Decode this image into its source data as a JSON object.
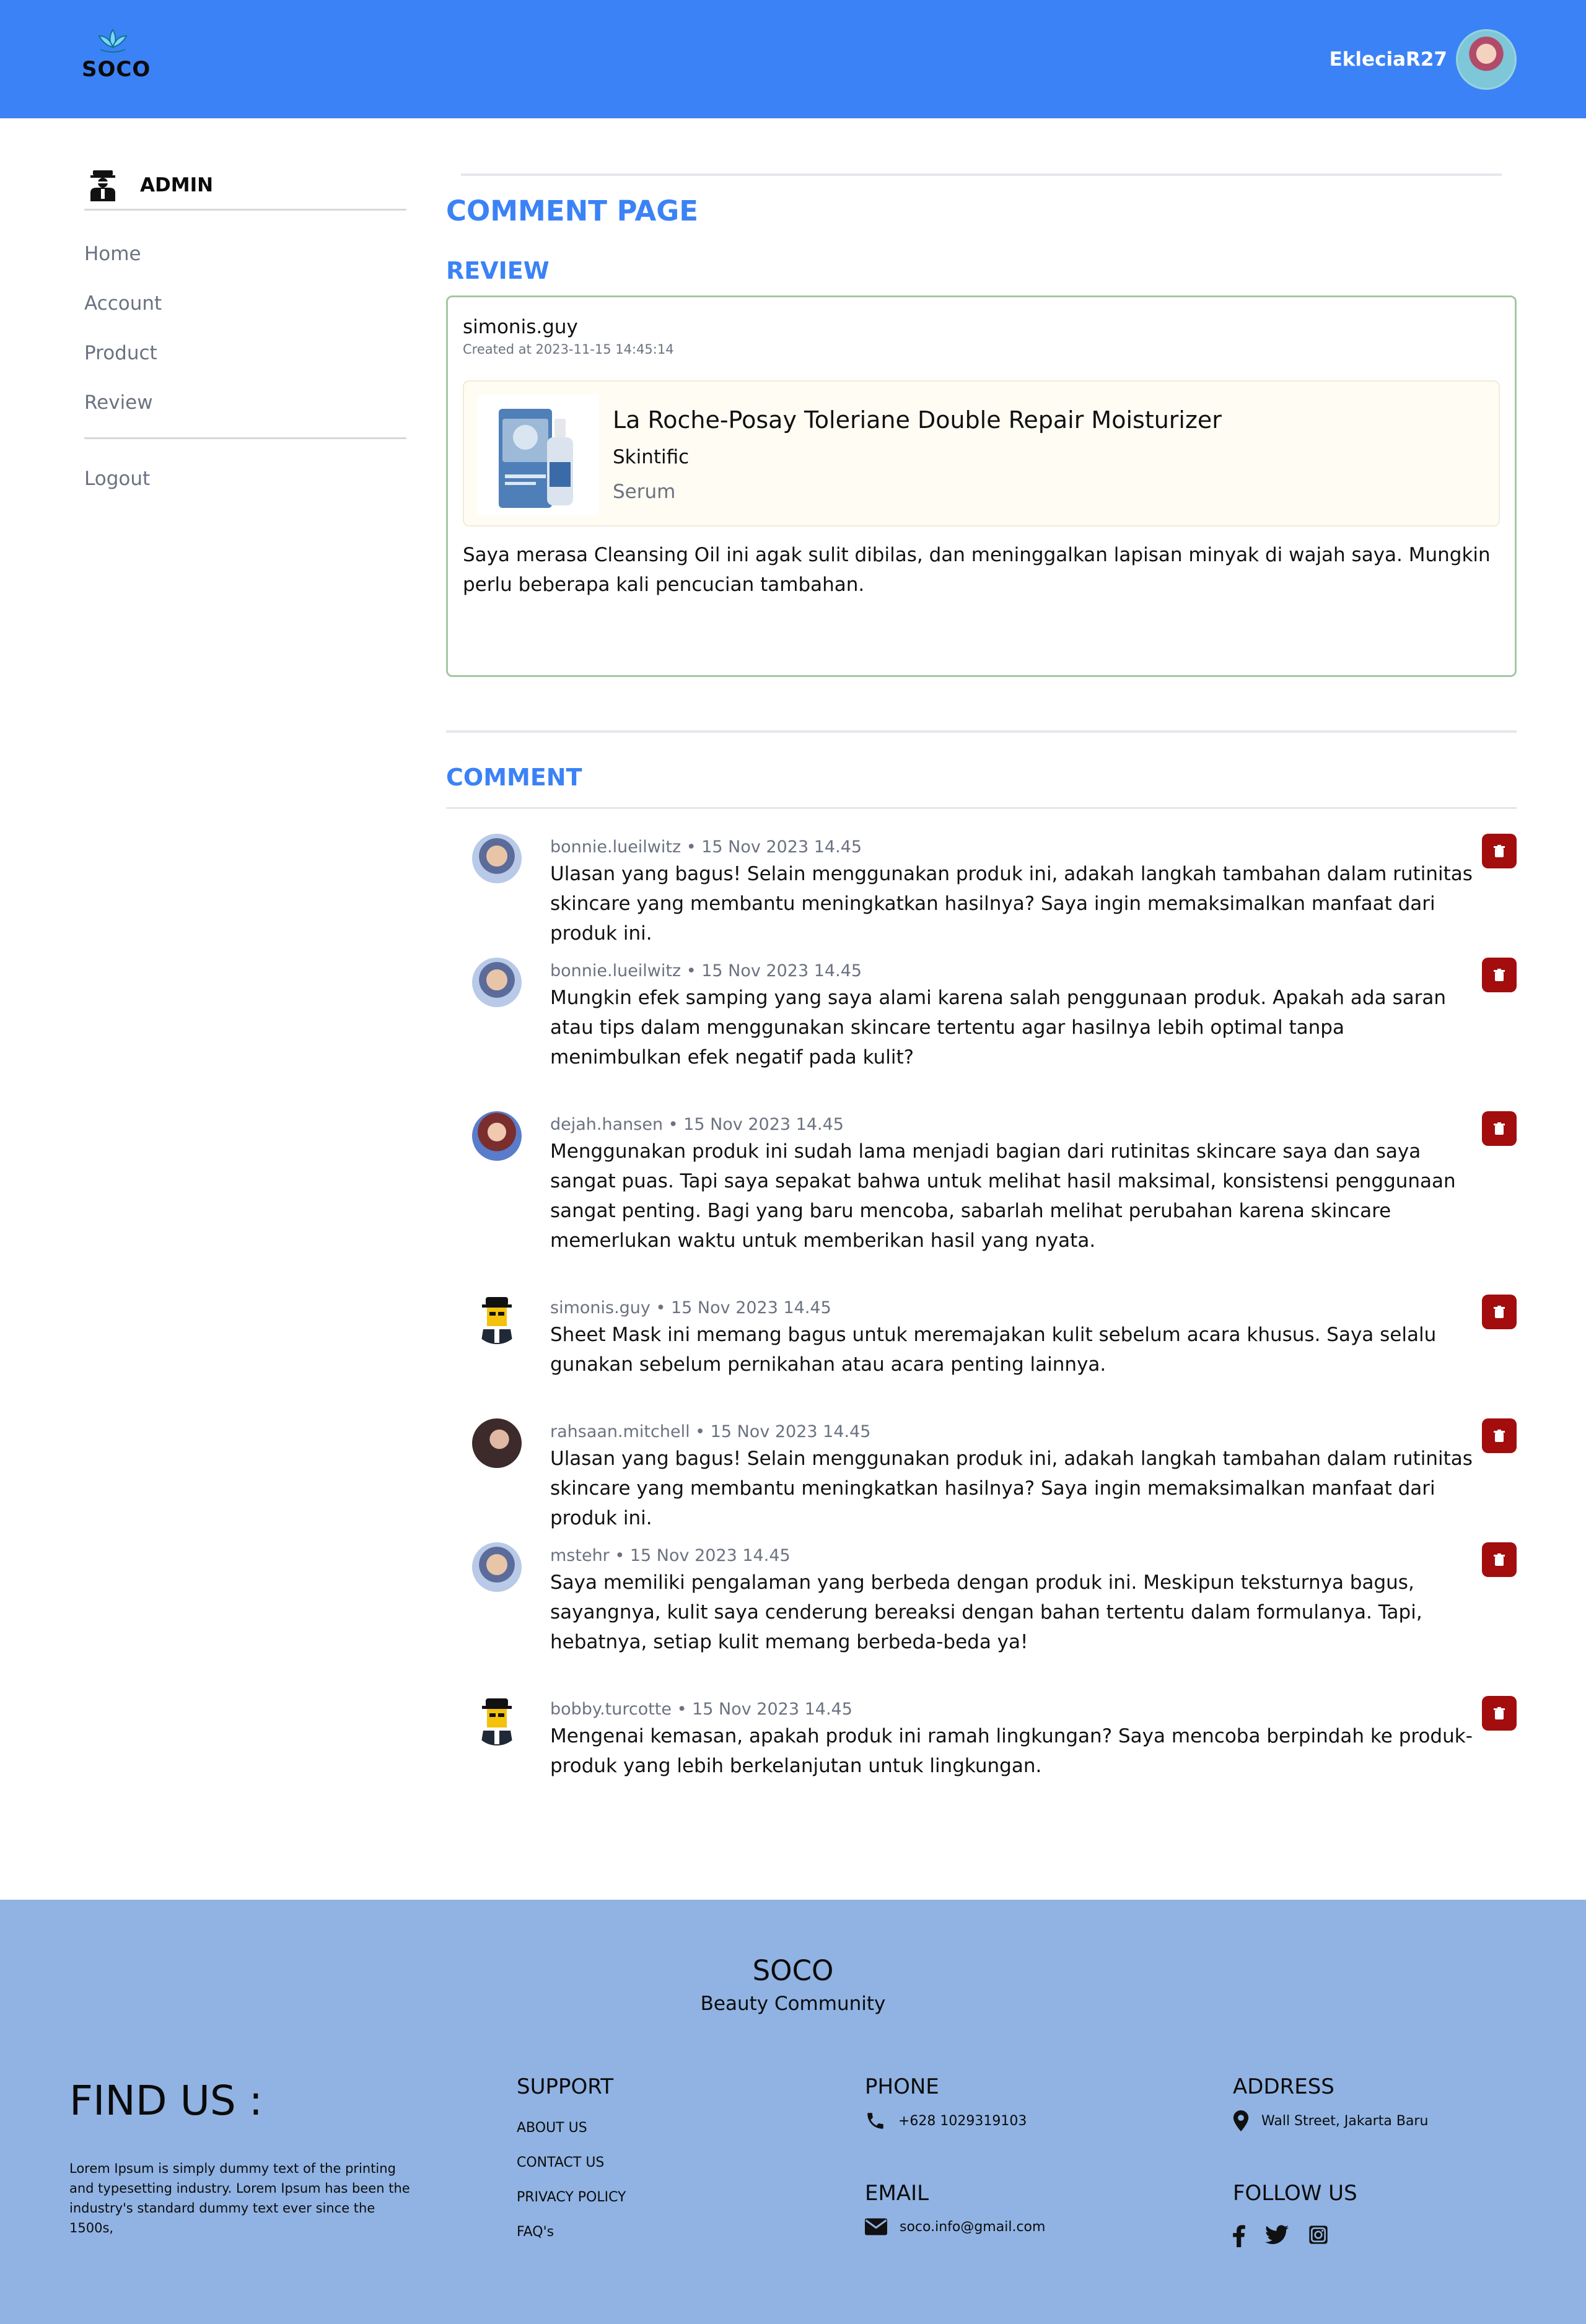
{
  "header": {
    "brand": "SOCO",
    "username": "EkleciaR27"
  },
  "sidebar": {
    "admin_label": "ADMIN",
    "items": [
      {
        "label": "Home"
      },
      {
        "label": "Account"
      },
      {
        "label": "Product"
      },
      {
        "label": "Review"
      }
    ],
    "logout": "Logout"
  },
  "main": {
    "page_title": "COMMENT PAGE",
    "review_title": "REVIEW",
    "review": {
      "user": "simonis.guy",
      "created": "Created at 2023-11-15 14:45:14",
      "product_name": "La Roche-Posay Toleriane Double Repair Moisturizer",
      "product_brand": "Skintific",
      "product_category": "Serum",
      "text": "Saya merasa Cleansing Oil ini agak sulit dibilas, dan meninggalkan lapisan minyak di wajah saya. Mungkin perlu beberapa kali pencucian tambahan."
    },
    "comment_title": "COMMENT",
    "comments": [
      {
        "meta": "bonnie.lueilwitz • 15 Nov 2023 14.45",
        "text": "Ulasan yang bagus! Selain menggunakan produk ini, adakah langkah tambahan dalam rutinitas skincare yang membantu meningkatkan hasilnya? Saya ingin memaksimalkan manfaat dari produk ini."
      },
      {
        "meta": "bonnie.lueilwitz • 15 Nov 2023 14.45",
        "text": "Mungkin efek samping yang saya alami karena salah penggunaan produk. Apakah ada saran atau tips dalam menggunakan skincare tertentu agar hasilnya lebih optimal tanpa menimbulkan efek negatif pada kulit?"
      },
      {
        "meta": "dejah.hansen • 15 Nov 2023 14.45",
        "text": "Menggunakan produk ini sudah lama menjadi bagian dari rutinitas skincare saya dan saya sangat puas. Tapi saya sepakat bahwa untuk melihat hasil maksimal, konsistensi penggunaan sangat penting. Bagi yang baru mencoba, sabarlah melihat perubahan karena skincare memerlukan waktu untuk memberikan hasil yang nyata."
      },
      {
        "meta": "simonis.guy • 15 Nov 2023 14.45",
        "text": "Sheet Mask ini memang bagus untuk meremajakan kulit sebelum acara khusus. Saya selalu gunakan sebelum pernikahan atau acara penting lainnya."
      },
      {
        "meta": "rahsaan.mitchell • 15 Nov 2023 14.45",
        "text": "Ulasan yang bagus! Selain menggunakan produk ini, adakah langkah tambahan dalam rutinitas skincare yang membantu meningkatkan hasilnya? Saya ingin memaksimalkan manfaat dari produk ini."
      },
      {
        "meta": "mstehr • 15 Nov 2023 14.45",
        "text": "Saya memiliki pengalaman yang berbeda dengan produk ini. Meskipun teksturnya bagus, sayangnya, kulit saya cenderung bereaksi dengan bahan tertentu dalam formulanya. Tapi, hebatnya, setiap kulit memang berbeda-beda ya!"
      },
      {
        "meta": "bobby.turcotte • 15 Nov 2023 14.45",
        "text": "Mengenai kemasan, apakah produk ini ramah lingkungan? Saya mencoba berpindah ke produk-produk yang lebih berkelanjutan untuk lingkungan."
      }
    ]
  },
  "footer": {
    "brand": "SOCO",
    "tagline": "Beauty Community",
    "findus": "FIND US :",
    "lorem": "Lorem Ipsum is simply dummy text of the printing and typesetting industry. Lorem Ipsum has been the industry's standard dummy text ever since the 1500s,",
    "support_title": "SUPPORT",
    "support_links": [
      "ABOUT US",
      "CONTACT US",
      "PRIVACY POLICY",
      "FAQ's"
    ],
    "phone_title": "PHONE",
    "phone": "+628 1029319103",
    "email_title": "EMAIL",
    "email": "soco.info@gmail.com",
    "address_title": "ADDRESS",
    "address": "Wall Street, Jakarta Baru",
    "follow_title": "FOLLOW US"
  },
  "colors": {
    "header_bg": "#3b82f6",
    "accent": "#3b82f6",
    "delete_button": "#a30d0d",
    "footer_bg": "#90b3e3"
  },
  "icons": [
    "lotus-logo-icon",
    "admin-icon",
    "trash-icon",
    "phone-icon",
    "envelope-icon",
    "map-pin-icon",
    "facebook-icon",
    "twitter-icon",
    "instagram-icon"
  ]
}
